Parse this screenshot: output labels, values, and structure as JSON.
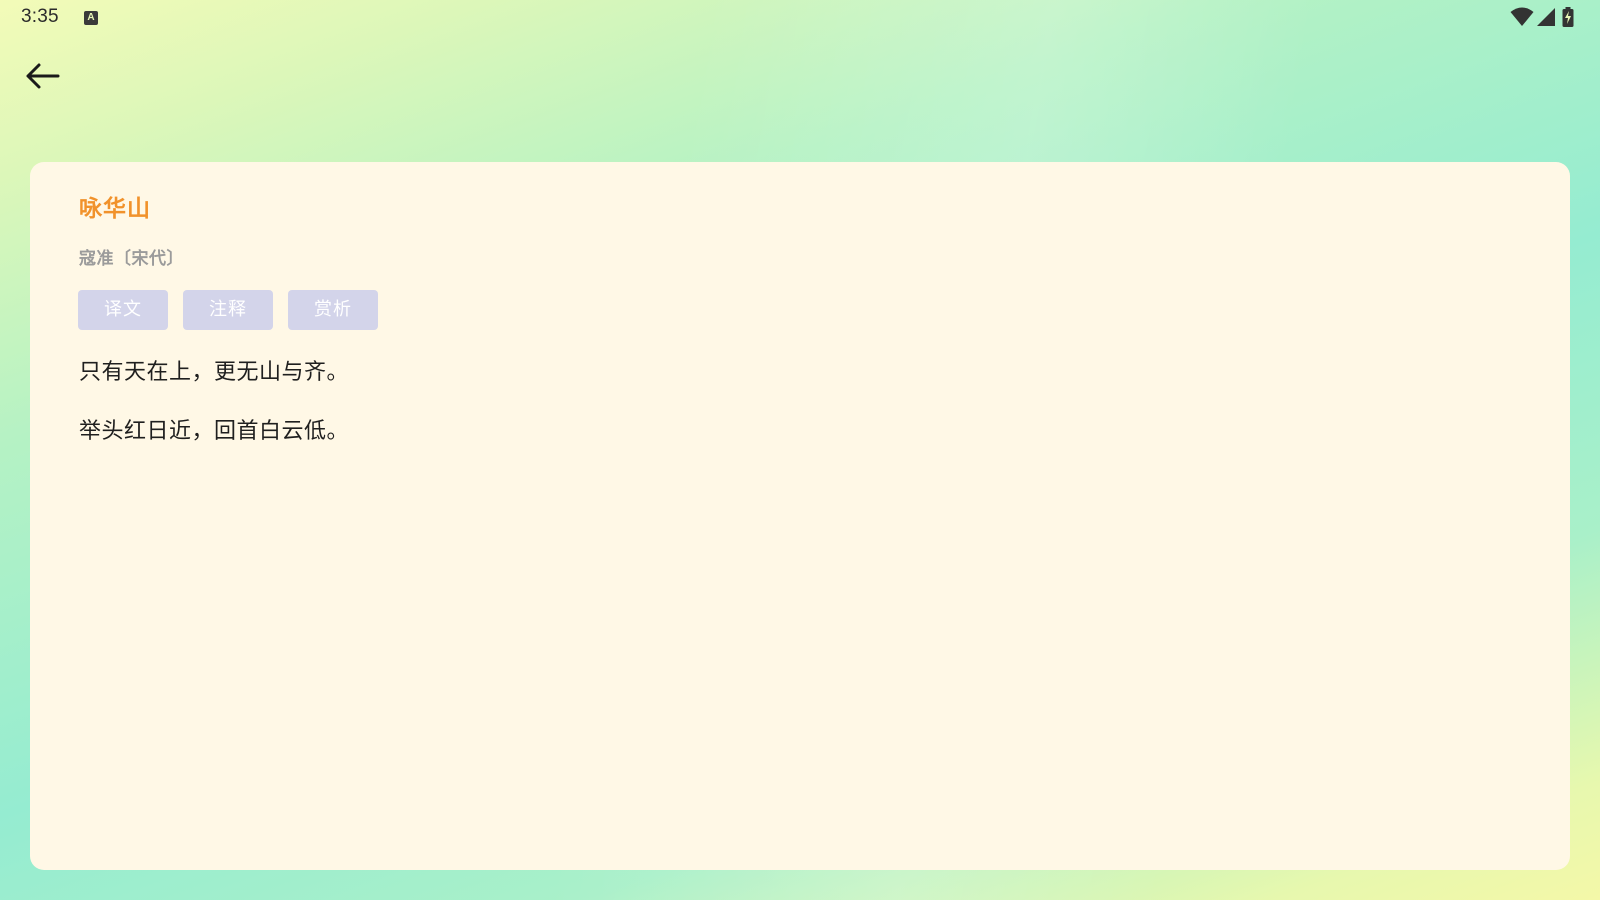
{
  "status_bar": {
    "time": "3:35",
    "keyboard_badge": "A",
    "icons": [
      "wifi-icon",
      "cellular-signal-icon",
      "battery-charging-icon"
    ]
  },
  "nav": {
    "back_icon": "arrow-left-icon"
  },
  "poem": {
    "title": "咏华山",
    "author": "寇准〔宋代〕",
    "tabs": [
      "译文",
      "注释",
      "赏析"
    ],
    "lines": [
      "只有天在上，更无山与齐。",
      "举头红日近，回首白云低。"
    ]
  },
  "colors": {
    "title": "#f1922b",
    "author": "#9b9b9b",
    "tab_bg": "#d3d4ea",
    "card_bg": "#fff8e6",
    "text": "#1f1f1f"
  }
}
